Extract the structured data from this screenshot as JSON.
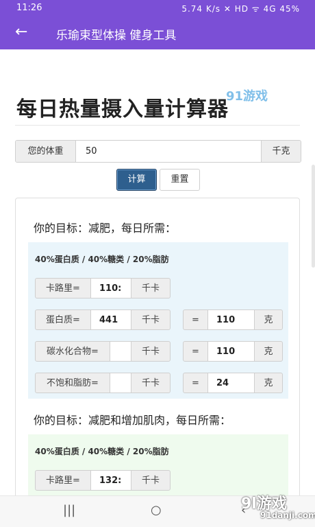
{
  "status": {
    "time": "11:26",
    "indicators": "5.74 K/s  ✕  HD  ᯤ 4G  45%"
  },
  "appbar": {
    "back_icon": "←",
    "title": "乐瑜束型体操 健身工具"
  },
  "page": {
    "heading": "每日热量摄入量计算器",
    "watermark": "91游戏",
    "weight": {
      "label": "您的体重",
      "value": "50",
      "unit": "千克"
    },
    "buttons": {
      "calc": "计算",
      "reset": "重置"
    }
  },
  "goal1": {
    "title": "你的目标：减肥，每日所需：",
    "ratio": "40%蛋白质 / 40%糖类 / 20%脂肪",
    "rows": [
      {
        "label": "卡路里=",
        "value": "110:",
        "unit": "千卡"
      },
      {
        "label": "蛋白质=",
        "value": "441",
        "unit": "千卡",
        "eq": "=",
        "grams": "110",
        "g_unit": "克"
      },
      {
        "label": "碳水化合物=",
        "value": "",
        "unit": "千卡",
        "eq": "=",
        "grams": "110",
        "g_unit": "克"
      },
      {
        "label": "不饱和脂肪=",
        "value": "",
        "unit": "千卡",
        "eq": "=",
        "grams": "24",
        "g_unit": "克"
      }
    ]
  },
  "goal2": {
    "title": "你的目标：减肥和增加肌肉，每日所需：",
    "ratio": "40%蛋白质 / 40%糖类 / 20%脂肪",
    "rows": [
      {
        "label": "卡路里=",
        "value": "132:",
        "unit": "千卡"
      }
    ]
  },
  "navbar": {
    "recent": "|||",
    "home": "○",
    "back": "‹"
  },
  "logo": {
    "big": "9l游戏",
    "small": "91danji.com"
  }
}
